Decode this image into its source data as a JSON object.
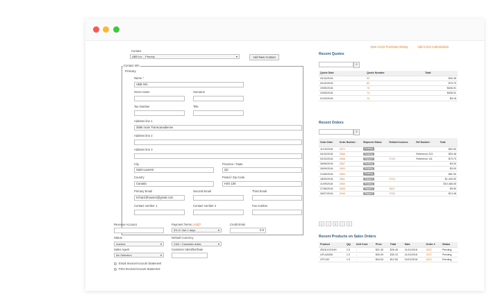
{
  "top_links": {
    "purchase_history": "View AACS Purchase History",
    "authorization": "Add AACS Authorization"
  },
  "contact": {
    "label": "Contact",
    "value": "ABB Inc. - Primary",
    "add_button": "Add New Contact"
  },
  "contact_info": {
    "legend": "Contact Info",
    "primary": "Primary",
    "name_label": "Name",
    "name_required": "*",
    "name_value": "ABB INC.",
    "given_name_label": "Given name",
    "surname_label": "Surname",
    "tax_number_label": "Tax Number",
    "title_label": "Title",
    "address1_label": "Address line 1",
    "address1_value": "3585 route Transcanadienne",
    "address2_label": "Address line 2",
    "address3_label": "Address line 3",
    "city_label": "City",
    "city_value": "Saint-Laurent",
    "province_label": "Province / State",
    "province_value": "QC",
    "country_label": "Country",
    "country_value": "Canada",
    "postal_label": "Postal / Zip Code",
    "postal_value": "H4S 1Z6",
    "primary_email_label": "Primary Email",
    "primary_email_value": "richard.bhouse1@gmail.com",
    "second_email_label": "Second Email",
    "third_email_label": "Third Email",
    "contact1_label": "Contact number 1",
    "contact2_label": "Contact number 2",
    "fax_label": "Fax number"
  },
  "account": {
    "revenue_label": "Revenue Account",
    "payment_terms_label": "Payment Terms",
    "payment_terms_add": "(Add)",
    "payment_terms_required": "*",
    "payment_terms_value": "3% if / Net 1 days",
    "credit_limit_label": "Credit limits",
    "credit_limit_value": "0.0",
    "status_label": "Status",
    "status_value": "Inactive",
    "currency_label": "Default Currency",
    "currency_value": "CAD / Canadian dollar",
    "sales_agent_label": "Sales Agent",
    "sales_agent_value": "No Selection",
    "customer_id_label": "Customer Identifier/Date",
    "radio1": "Email Invoice/Account Statement",
    "radio2": "Print Invoice/Account Statement"
  },
  "recent_quotes": {
    "title": "Recent Quotes",
    "headers": [
      "Quote Date",
      "Quote Number",
      "Total"
    ],
    "rows": [
      [
        "04/10/2018",
        "80",
        "$53.48"
      ],
      [
        "04/10/2018",
        "82",
        "$79.70"
      ],
      [
        "23/05/2018",
        "76",
        "$636.91"
      ],
      [
        "23/05/2018",
        "74",
        "$636.91"
      ],
      [
        "01/29/2018",
        "72",
        "$5.18"
      ]
    ]
  },
  "recent_orders": {
    "title": "Recent Orders",
    "headers": [
      "Order Date:",
      "Order Number:",
      "Shipment Status",
      "Related Invoices:",
      "Ref Number:",
      "Total"
    ],
    "rows": [
      [
        "11/10/2018",
        "2872",
        "Pending",
        "",
        "",
        "$62.50"
      ],
      [
        "04/10/2018",
        "2866",
        "Pending",
        "",
        "Reference 222",
        "$53.48"
      ],
      [
        "04/10/2018",
        "2868",
        "Shipped",
        "3748",
        "Reference 111",
        "$79.70"
      ],
      [
        "28/08/2018",
        "2857",
        "Pending",
        "",
        "",
        "$0.00"
      ],
      [
        "26/09/2018",
        "2863",
        "Pending",
        "",
        "",
        "$0.00"
      ],
      [
        "21/08/2018",
        "2859",
        "Pending",
        "",
        "",
        "$81.90"
      ],
      [
        "18/09/2018",
        "2861",
        "Shipped",
        "3743",
        "",
        "$1,400.00"
      ],
      [
        "11/09/2018",
        "2860",
        "Pending",
        "",
        "",
        "$10,468.35"
      ],
      [
        "27/08/2018",
        "2856",
        "Shipped",
        "3837",
        "",
        "$5.50"
      ],
      [
        "26/07/2018",
        "2846",
        "Shipped",
        "3758",
        "",
        "$13.48"
      ]
    ],
    "pager": [
      "«",
      "‹",
      "1",
      "›",
      "»"
    ]
  },
  "recent_products": {
    "title": "Recent Products on Sales Orders",
    "headers": [
      "Product",
      "Qty",
      "Unit Cost",
      "Price",
      "Total",
      "Date",
      "Order #",
      "Status"
    ],
    "rows": [
      [
        "ZB28-0131NH",
        "2.0",
        "-",
        "$21.00",
        "$26.40",
        "11/10/2018",
        "2872",
        "Pending"
      ],
      [
        "LIR-AA006",
        "1.0",
        "-",
        "$30.00",
        "$30.10",
        "11/10/2018",
        "2872",
        "Pending"
      ],
      [
        "VPI-332",
        "1.0",
        "-",
        "$18.00",
        "$12.60",
        "04/10/2018",
        "2872",
        "Pending"
      ]
    ]
  }
}
